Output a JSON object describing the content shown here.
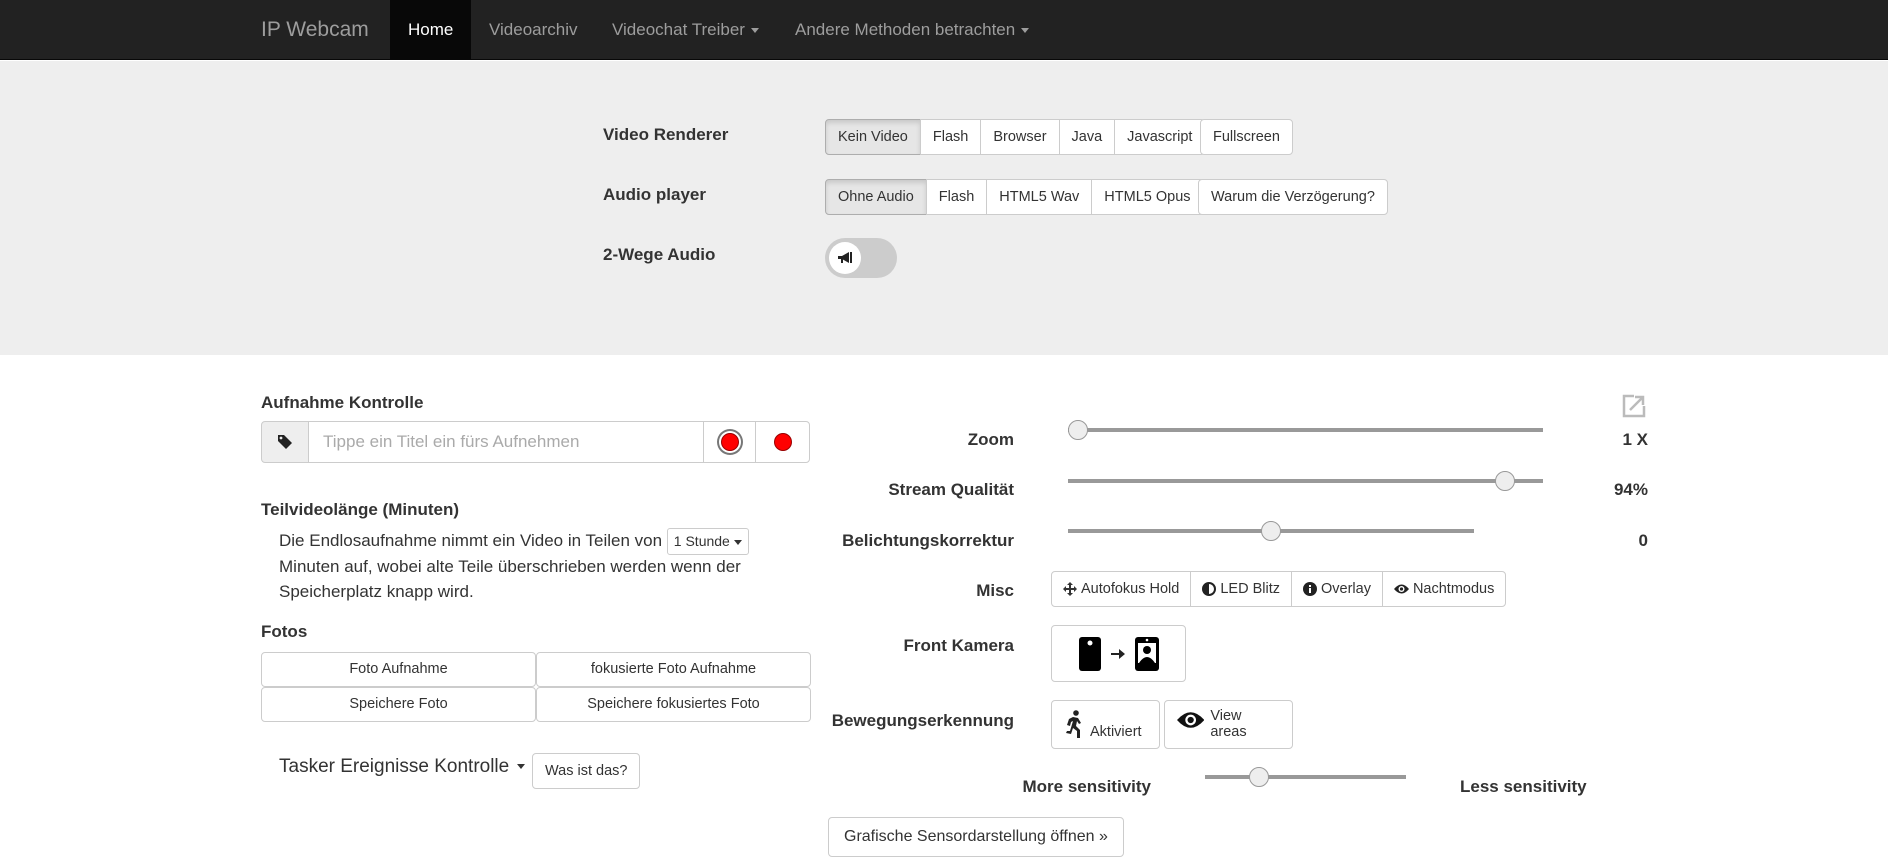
{
  "navbar": {
    "brand": "IP Webcam",
    "items": [
      {
        "label": "Home",
        "active": true,
        "dropdown": false
      },
      {
        "label": "Videoarchiv",
        "active": false,
        "dropdown": false
      },
      {
        "label": "Videochat Treiber",
        "active": false,
        "dropdown": true
      },
      {
        "label": "Andere Methoden betrachten",
        "active": false,
        "dropdown": true
      }
    ]
  },
  "settings": {
    "video_renderer": {
      "label": "Video Renderer",
      "options": [
        "Kein Video",
        "Flash",
        "Browser",
        "Java",
        "Javascript"
      ],
      "selected": "Kein Video",
      "fullscreen_label": "Fullscreen"
    },
    "audio_player": {
      "label": "Audio player",
      "options": [
        "Ohne Audio",
        "Flash",
        "HTML5 Wav",
        "HTML5 Opus"
      ],
      "selected": "Ohne Audio",
      "help_label": "Warum die Verzögerung?"
    },
    "two_way_audio": {
      "label": "2-Wege Audio",
      "enabled": false,
      "icon": "bullhorn-icon"
    }
  },
  "recording": {
    "title": "Aufnahme Kontrolle",
    "input_placeholder": "Tippe ein Titel ein fürs Aufnehmen",
    "input_value": "",
    "tag_icon": "tag-icon",
    "record_buttons": [
      "record-ring-icon",
      "record-dot-icon"
    ]
  },
  "segment": {
    "title": "Teilvideolänge (Minuten)",
    "text_before": "Die Endlosaufnahme nimmt ein Video in Teilen von",
    "selected_duration": "1 Stunde",
    "text_after": "Minuten auf, wobei alte Teile überschrieben werden wenn der Speicherplatz knapp wird."
  },
  "photos": {
    "title": "Fotos",
    "buttons": [
      "Foto Aufnahme",
      "fokusierte Foto Aufnahme",
      "Speichere Foto",
      "Speichere fokusiertes Foto"
    ]
  },
  "tasker": {
    "label": "Tasker Ereignisse Kontrolle",
    "help_label": "Was ist das?"
  },
  "controls": {
    "zoom": {
      "label": "Zoom",
      "value_text": "1 X",
      "fraction": 0.0
    },
    "stream_quality": {
      "label": "Stream Qualität",
      "value_text": "94%",
      "fraction": 0.92
    },
    "exposure": {
      "label": "Belichtungskorrektur",
      "value_text": "0",
      "fraction": 0.5
    },
    "misc": {
      "label": "Misc",
      "buttons": [
        {
          "label": "Autofokus Hold",
          "icon": "move-icon"
        },
        {
          "label": "LED Blitz",
          "icon": "adjust-icon"
        },
        {
          "label": "Overlay",
          "icon": "info-icon"
        },
        {
          "label": "Nachtmodus",
          "icon": "eye-icon"
        }
      ]
    },
    "front_camera": {
      "label": "Front Kamera"
    },
    "motion": {
      "label": "Bewegungserkennung",
      "activate_label": "Aktiviert",
      "view_areas_label": "View areas"
    },
    "sensitivity": {
      "more_label": "More sensitivity",
      "less_label": "Less sensitivity",
      "fraction": 0.27
    },
    "sensor_button_label": "Grafische Sensordarstellung öffnen »"
  }
}
